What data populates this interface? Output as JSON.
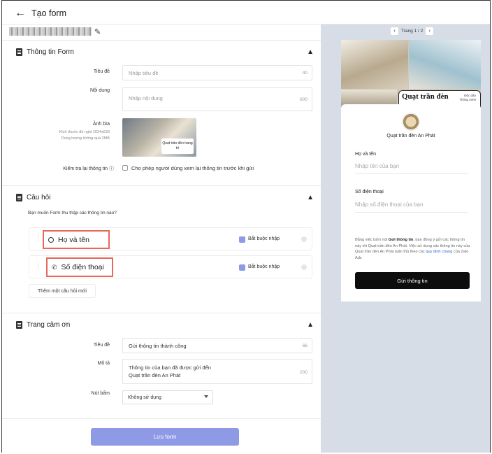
{
  "header": {
    "title": "Tạo form"
  },
  "sections": {
    "info": {
      "title": "Thông tin Form",
      "title_label": "Tiêu đề",
      "title_placeholder": "Nhập tiêu đề",
      "title_count": "40",
      "content_label": "Nội dung",
      "content_placeholder": "Nhập nội dung",
      "content_count": "600",
      "cover_label": "Ảnh bìa",
      "cover_hint_1": "Kích thước đề nghị 1024x533",
      "cover_hint_2": "Dung lượng không quá 2MB",
      "cover_text": "Quạt trần đèn trang trí",
      "verify_label": "Kiểm tra lại thông tin",
      "verify_checkbox_label": "Cho phép người dùng xem lại thông tin trước khi gửi"
    },
    "questions": {
      "title": "Câu hỏi",
      "prompt": "Bạn muốn Form thu thập các thông tin nào?",
      "items": [
        {
          "label": "Họ và tên",
          "required_label": "Bắt buộc nhập"
        },
        {
          "label": "Số điện thoại",
          "required_label": "Bắt buộc nhập"
        }
      ],
      "add_button": "Thêm một câu hỏi mới"
    },
    "thanks": {
      "title": "Trang cảm ơn",
      "title_label": "Tiêu đề",
      "title_value": "Gửi thông tin thành công",
      "title_count": "66",
      "desc_label": "Mô tả",
      "desc_line_1": "Thông tin của bạn đã được gửi đến",
      "desc_line_2": "Quạt trần đèn An Phát",
      "desc_count": "200",
      "button_label": "Nút bấm",
      "button_value": "Không sử dụng"
    }
  },
  "save_button": "Lưu form",
  "preview": {
    "pager": "Trang 1 / 2",
    "banner_title": "Quạt trần đèn",
    "banner_title_2": "trang trí",
    "banner_side_1": "Độc đáo",
    "banner_side_2": "Thông minh",
    "business_name": "Quạt trần đèn An Phát",
    "field_1_label": "Họ và tên",
    "field_1_placeholder": "Nhập tên của bạn",
    "field_2_label": "Số điện thoại",
    "field_2_placeholder": "Nhập số điện thoại của bạn",
    "consent_1": "Bằng việc bấm nút ",
    "consent_bold": "Gửi thông tin",
    "consent_2": ", bạn đồng ý gửi các thông tin này tới Quạt trần đèn An Phát. Việc sử dụng các thông tin này của Quạt trần đèn An Phát tuân thủ theo các ",
    "consent_link": "quy định chung",
    "consent_3": " của Zalo Ads",
    "submit": "Gửi thông tin"
  },
  "colors": {
    "accent": "#8e9ae5",
    "highlight_border": "#e8685a",
    "preview_bg": "#d7dde6"
  }
}
